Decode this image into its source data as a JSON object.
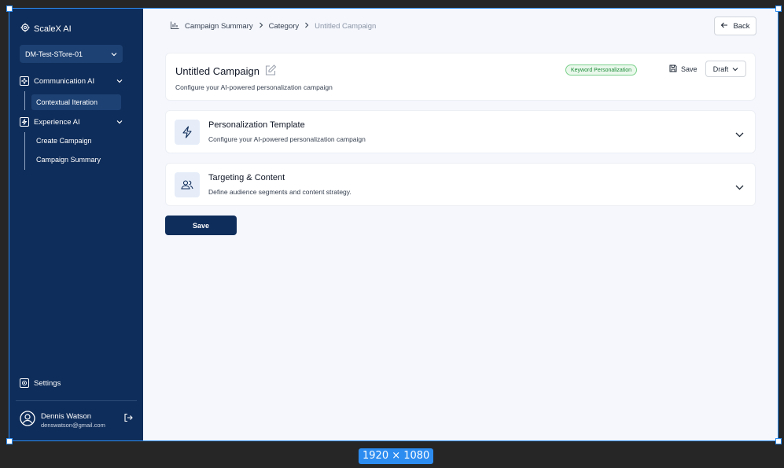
{
  "brand": {
    "name": "ScaleX AI",
    "icon": "gear-icon"
  },
  "store_select": {
    "value": "DM-Test-STore-01"
  },
  "sidebar": {
    "groups": [
      {
        "label": "Communication AI",
        "icon": "sparkle-icon",
        "items": [
          "Contextual Iteration"
        ],
        "active_item": "Contextual Iteration"
      },
      {
        "label": "Experience AI",
        "icon": "bolt-icon",
        "items": [
          "Create Campaign",
          "Campaign Summary"
        ]
      }
    ],
    "settings_label": "Settings",
    "user": {
      "name": "Dennis Watson",
      "email": "denswatson@gmail.com"
    }
  },
  "breadcrumb": {
    "items": [
      "Campaign Summary",
      "Category"
    ],
    "current": "Untitled Campaign",
    "icon": "bar-chart-icon"
  },
  "back_label": "Back",
  "campaign": {
    "title": "Untitled Campaign",
    "description": "Configure your AI-powered personalization campaign",
    "badge": "Keyword Personalization",
    "save_label": "Save",
    "status": "Draft"
  },
  "sections": [
    {
      "title": "Personalization Template",
      "description": "Configure your AI-powered personalization campaign",
      "icon": "bolt-icon"
    },
    {
      "title": "Targeting & Content",
      "description": "Define audience segments and content strategy.",
      "icon": "users-icon"
    }
  ],
  "save_button_label": "Save",
  "overlay": {
    "dimension_label": "1920 × 1080"
  },
  "colors": {
    "sidebar_bg": "#0f2d5a",
    "accent": "#2d8cf0",
    "badge_green": "#1b8a36"
  }
}
